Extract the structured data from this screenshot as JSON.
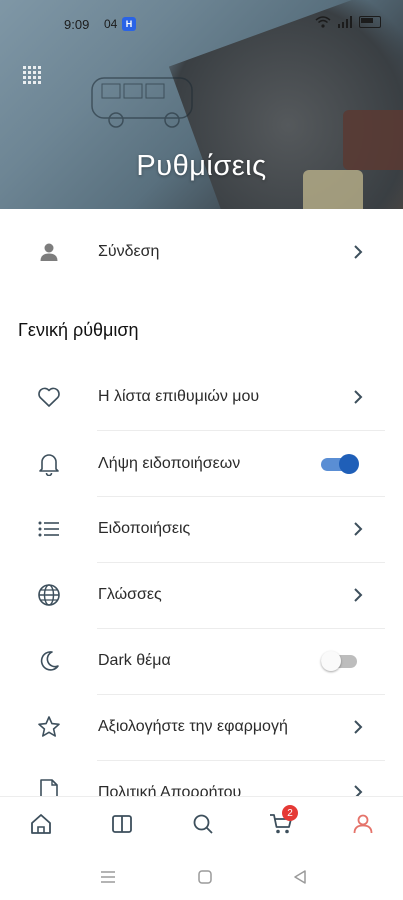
{
  "status_bar": {
    "time": "9:09",
    "extra": "04",
    "app_badge": "H",
    "signal_text": "ıl"
  },
  "header": {
    "title": "Ρυθμίσεις"
  },
  "account": {
    "login_label": "Σύνδεση"
  },
  "general": {
    "section_title": "Γενική ρύθμιση",
    "items": [
      {
        "label": "Η λίστα επιθυμιών μου",
        "icon": "heart-icon",
        "control": "chevron"
      },
      {
        "label": "Λήψη ειδοποιήσεων",
        "icon": "bell-icon",
        "control": "toggle",
        "enabled": true
      },
      {
        "label": "Ειδοποιήσεις",
        "icon": "list-icon",
        "control": "chevron"
      },
      {
        "label": "Γλώσσες",
        "icon": "globe-icon",
        "control": "chevron"
      },
      {
        "label": "Dark θέμα",
        "icon": "moon-icon",
        "control": "toggle",
        "enabled": false
      },
      {
        "label": "Αξιολογήστε την εφαρμογή",
        "icon": "star-icon",
        "control": "chevron"
      },
      {
        "label": "Πολιτική Απορρήτου",
        "icon": "document-icon",
        "control": "chevron"
      }
    ]
  },
  "bottom_nav": {
    "items": [
      "home-icon",
      "catalog-icon",
      "search-icon",
      "cart-icon",
      "profile-icon"
    ],
    "cart_count": "2",
    "active": "profile-icon"
  },
  "colors": {
    "accent": "#1f5fb8",
    "icon": "#3d4f5c",
    "active_tab": "#e5736a",
    "badge": "#e53935"
  }
}
